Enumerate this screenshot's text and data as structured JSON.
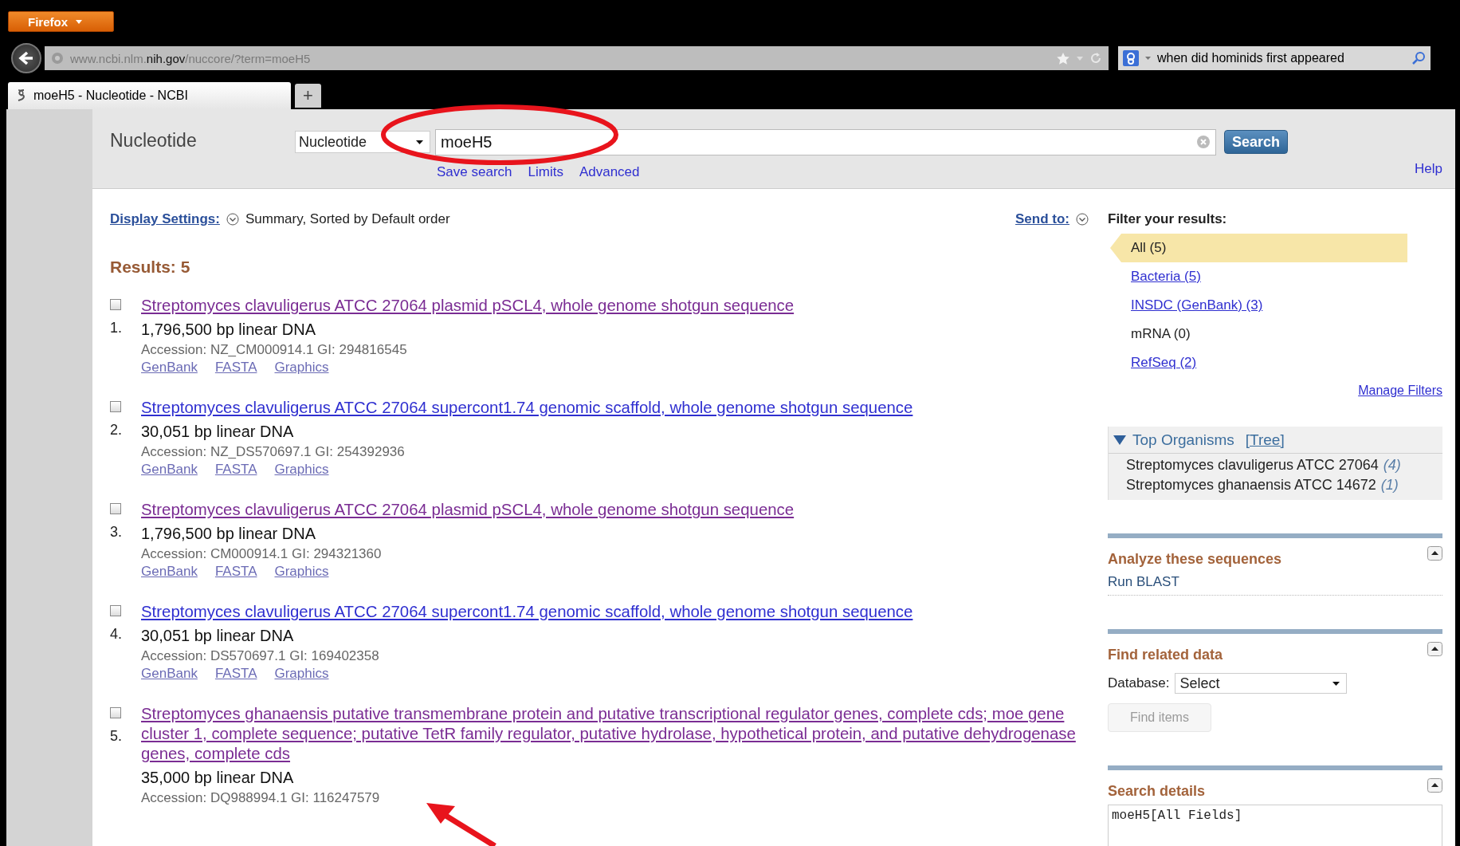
{
  "browser": {
    "menu_button": "Firefox",
    "address": {
      "prefix": "www.ncbi.nlm.",
      "domain": "nih.gov",
      "path": "/nuccore/?term=moeH5"
    },
    "web_search": "when did hominids first appeared",
    "tabs": [
      {
        "title": "moeH5 - Nucleotide - NCBI",
        "selected": true
      }
    ],
    "new_tab": "+"
  },
  "header": {
    "title": "Nucleotide",
    "database": "Nucleotide",
    "query": "moeH5",
    "search_button": "Search",
    "links": [
      "Save search",
      "Limits",
      "Advanced"
    ],
    "help": "Help"
  },
  "display": {
    "settings_link": "Display Settings:",
    "settings_text": "Summary, Sorted by Default order",
    "send_to": "Send to:"
  },
  "results_heading": "Results: 5",
  "results": [
    {
      "number": "1.",
      "checked": false,
      "visited": true,
      "title": "Streptomyces clavuligerus ATCC 27064 plasmid pSCL4, whole genome shotgun sequence",
      "size": "1,796,500 bp linear DNA",
      "accession": "Accession: NZ_CM000914.1 GI: 294816545",
      "links": [
        "GenBank",
        "FASTA",
        "Graphics"
      ]
    },
    {
      "number": "2.",
      "checked": false,
      "visited": false,
      "title": "Streptomyces clavuligerus ATCC 27064 supercont1.74 genomic scaffold, whole genome shotgun sequence",
      "size": "30,051 bp linear DNA",
      "accession": "Accession: NZ_DS570697.1 GI: 254392936",
      "links": [
        "GenBank",
        "FASTA",
        "Graphics"
      ]
    },
    {
      "number": "3.",
      "checked": false,
      "visited": true,
      "title": "Streptomyces clavuligerus ATCC 27064 plasmid pSCL4, whole genome shotgun sequence",
      "size": "1,796,500 bp linear DNA",
      "accession": "Accession: CM000914.1 GI: 294321360",
      "links": [
        "GenBank",
        "FASTA",
        "Graphics"
      ]
    },
    {
      "number": "4.",
      "checked": false,
      "visited": false,
      "title": "Streptomyces clavuligerus ATCC 27064 supercont1.74 genomic scaffold, whole genome shotgun sequence",
      "size": "30,051 bp linear DNA",
      "accession": "Accession: DS570697.1 GI: 169402358",
      "links": [
        "GenBank",
        "FASTA",
        "Graphics"
      ]
    },
    {
      "number": "5.",
      "checked": false,
      "visited": true,
      "title": "Streptomyces ghanaensis putative transmembrane protein and putative transcriptional regulator genes, complete cds; moe gene cluster 1, complete sequence; putative TetR family regulator, putative hydrolase, hypothetical protein, and putative dehydrogenase genes, complete cds",
      "size": "35,000 bp linear DNA",
      "accession": "Accession: DQ988994.1 GI: 116247579"
    }
  ],
  "filters": {
    "heading": "Filter your results:",
    "items": [
      {
        "label": "All (5)",
        "selected": true,
        "disabled": false
      },
      {
        "label": "Bacteria (5)",
        "selected": false,
        "disabled": false
      },
      {
        "label": "INSDC (GenBank) (3)",
        "selected": false,
        "disabled": false
      },
      {
        "label": "mRNA (0)",
        "selected": false,
        "disabled": true
      },
      {
        "label": "RefSeq (2)",
        "selected": false,
        "disabled": false
      }
    ],
    "manage": "Manage Filters"
  },
  "top_organisms": {
    "title": "Top Organisms",
    "tree": "[Tree]",
    "expanded": true,
    "items": [
      {
        "name": "Streptomyces clavuligerus ATCC 27064",
        "count": "(4)"
      },
      {
        "name": "Streptomyces ghanaensis ATCC 14672",
        "count": "(1)"
      }
    ]
  },
  "analyze": {
    "title": "Analyze these sequences",
    "links": [
      "Run BLAST"
    ]
  },
  "related": {
    "title": "Find related data",
    "label": "Database:",
    "select": "Select",
    "button": "Find items",
    "button_disabled": true
  },
  "search_details": {
    "title": "Search details",
    "query": "moeH5[All Fields]"
  }
}
